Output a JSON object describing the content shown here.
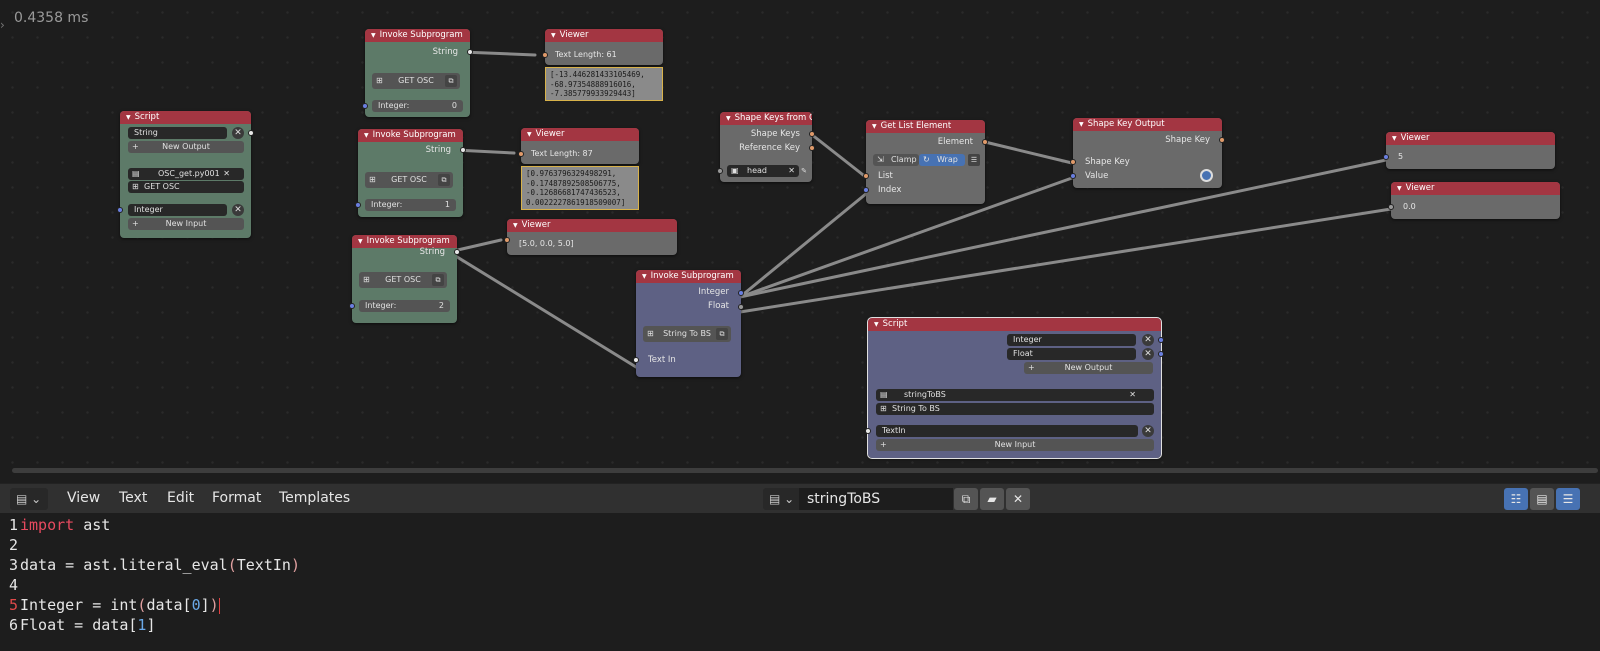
{
  "timing": "0.4358 ms",
  "nodes": {
    "script_left": {
      "title": "Script",
      "output_name": "String",
      "new_output": "New Output",
      "script_file": "OSC_get.py001",
      "subprogram_name": "GET OSC",
      "input_name": "Integer",
      "new_input": "New Input"
    },
    "invoke1": {
      "title": "Invoke Subprogram",
      "output": "String",
      "program": "GET OSC",
      "int_label": "Integer:",
      "int_value": "0"
    },
    "invoke2": {
      "title": "Invoke Subprogram",
      "output": "String",
      "program": "GET OSC",
      "int_label": "Integer:",
      "int_value": "1"
    },
    "invoke3": {
      "title": "Invoke Subprogram",
      "output": "String",
      "program": "GET OSC",
      "int_label": "Integer:",
      "int_value": "2"
    },
    "viewer1": {
      "title": "Viewer",
      "text_length": "Text Length: 61",
      "content": "[-13.446281433105469,\n-68.97354888916016,\n-7.385779933929443]"
    },
    "viewer2": {
      "title": "Viewer",
      "text_length": "Text Length: 87",
      "content": "[0.9763796329498291,\n-0.17487892508506775,\n-0.12686681747436523,\n0.0022227861918509007]"
    },
    "viewer3": {
      "title": "Viewer",
      "content": "[5.0, 0.0, 5.0]"
    },
    "shape_keys": {
      "title": "Shape Keys from Ob...",
      "out1": "Shape Keys",
      "out2": "Reference Key",
      "object": "head"
    },
    "get_list": {
      "title": "Get List Element",
      "out": "Element",
      "clamp": "Clamp",
      "wrap": "Wrap",
      "in1": "List",
      "in2": "Index"
    },
    "shape_key_output": {
      "title": "Shape Key Output",
      "out": "Shape Key",
      "in1": "Shape Key",
      "in2": "Value"
    },
    "viewer4": {
      "title": "Viewer",
      "content": "5"
    },
    "viewer5": {
      "title": "Viewer",
      "content": "0.0"
    },
    "invoke_bs": {
      "title": "Invoke Subprogram",
      "out1": "Integer",
      "out2": "Float",
      "program": "String To BS",
      "in": "Text In"
    },
    "script_right": {
      "title": "Script",
      "output1": "Integer",
      "output2": "Float",
      "new_output": "New Output",
      "script_file": "stringToBS",
      "subprogram_name": "String To BS",
      "input_name": "TextIn",
      "new_input": "New Input"
    }
  },
  "text_editor": {
    "menus": [
      "View",
      "Text",
      "Edit",
      "Format",
      "Templates"
    ],
    "document_name": "stringToBS",
    "lines": [
      {
        "n": "1",
        "tokens": [
          [
            "kw",
            "import"
          ],
          [
            "id",
            " ast"
          ]
        ]
      },
      {
        "n": "2",
        "tokens": []
      },
      {
        "n": "3",
        "tokens": [
          [
            "id",
            "data = ast.literal_eval"
          ],
          [
            "par",
            "("
          ],
          [
            "id",
            "TextIn"
          ],
          [
            "par",
            ")"
          ]
        ]
      },
      {
        "n": "4",
        "tokens": []
      },
      {
        "n": "5",
        "tokens": [
          [
            "id",
            "Integer = int"
          ],
          [
            "par",
            "("
          ],
          [
            "id",
            "data["
          ],
          [
            "num",
            "0"
          ],
          [
            "id",
            "]"
          ],
          [
            "par",
            ")"
          ]
        ],
        "current": true
      },
      {
        "n": "6",
        "tokens": [
          [
            "id",
            "Float = data["
          ],
          [
            "num",
            "1"
          ],
          [
            "id",
            "]"
          ]
        ]
      }
    ]
  },
  "colors": {
    "node_header": "#a33642",
    "green_node": "#5d7a68",
    "blue_node": "#5e6184",
    "grey_node": "#6a6a6a",
    "keyword": "#e84a5f",
    "number": "#6ba9e8"
  }
}
